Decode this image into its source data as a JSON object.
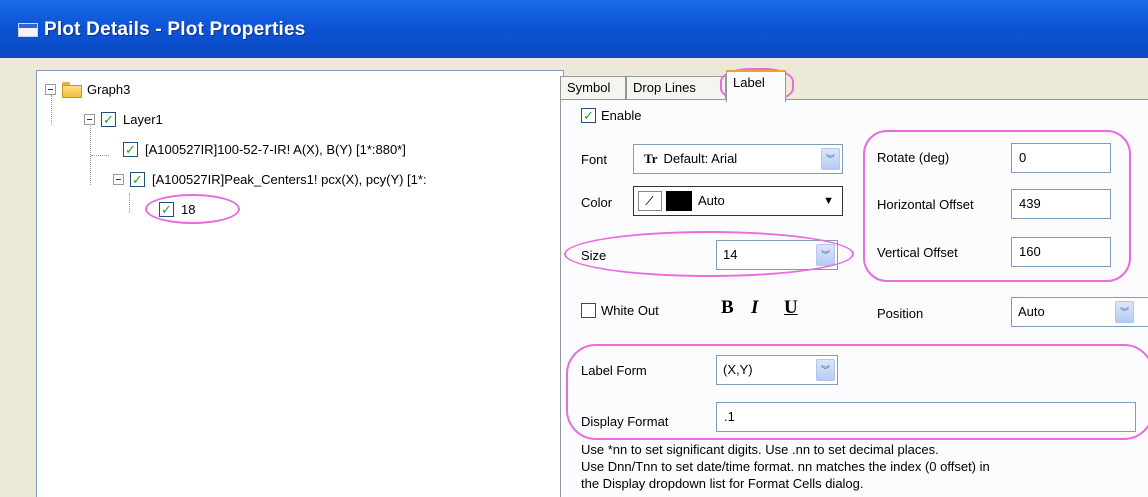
{
  "window": {
    "title": "Plot Details - Plot Properties"
  },
  "tree": {
    "root": "Graph3",
    "layer": "Layer1",
    "plot1": "[A100527IR]100-52-7-IR! A(X), B(Y) [1*:880*]",
    "plot2": "[A100527IR]Peak_Centers1! pcx(X), pcy(Y) [1*:",
    "point": "18"
  },
  "tabs": [
    "Symbol",
    "Drop Lines",
    "Label"
  ],
  "label_tab": {
    "enable_label": "Enable",
    "enable_checked": true,
    "font_label": "Font",
    "font_value": "Default: Arial",
    "font_icon_glyph": "Tr",
    "color_label": "Color",
    "color_value": "Auto",
    "color_swatch": "#000000",
    "size_label": "Size",
    "size_value": "14",
    "rotate_label": "Rotate (deg)",
    "rotate_value": "0",
    "hoffset_label": "Horizontal Offset",
    "hoffset_value": "439",
    "voffset_label": "Vertical Offset",
    "voffset_value": "160",
    "whiteout_label": "White Out",
    "whiteout_checked": false,
    "bold_glyph": "B",
    "italic_glyph": "I",
    "underline_glyph": "U",
    "position_label": "Position",
    "position_value": "Auto",
    "labelform_label": "Label Form",
    "labelform_value": "(X,Y)",
    "displayformat_label": "Display Format",
    "displayformat_value": ".1",
    "hint_line1": "Use *nn to set significant digits. Use .nn to set decimal places.",
    "hint_line2": "Use Dnn/Tnn to set date/time format. nn matches the index (0 offset) in",
    "hint_line3": "the Display dropdown list for Format Cells dialog."
  },
  "colors": {
    "titlebar": "#0d55d6",
    "highlight_ellipse": "#e86ce0",
    "check": "#21a121",
    "active_tab_accent": "#f0a132"
  },
  "icons": {
    "checkmark": "✓",
    "dropdown": "▼",
    "chevron": "︾"
  }
}
